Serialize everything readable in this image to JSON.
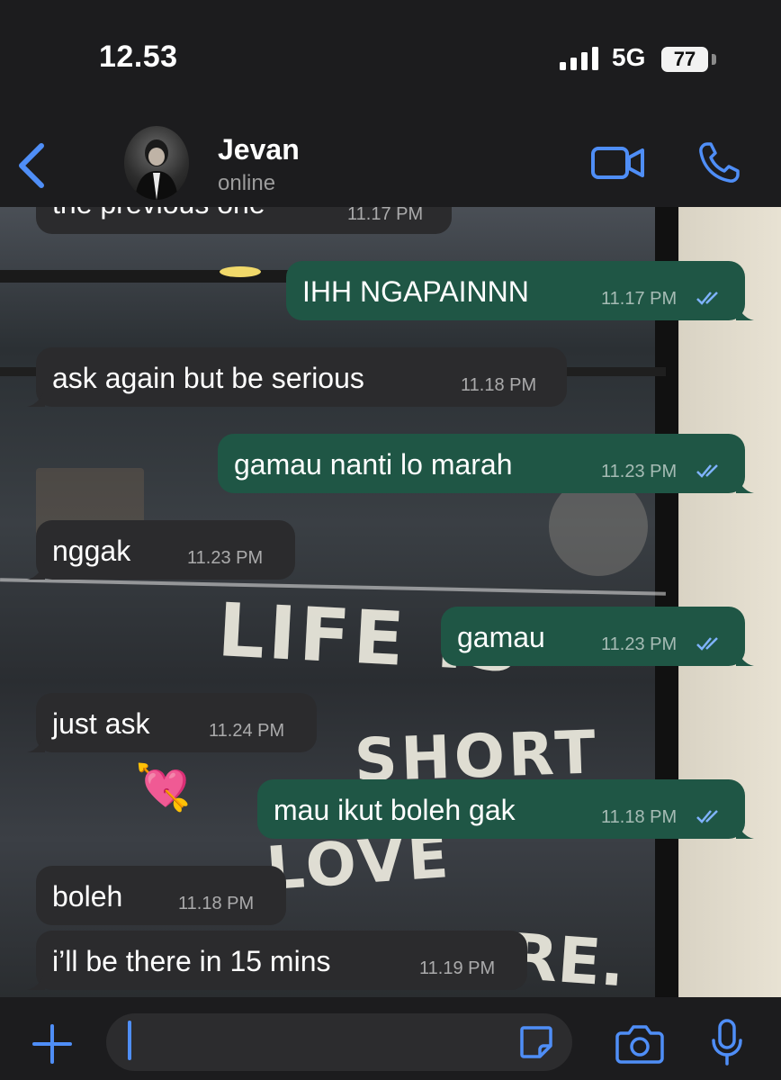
{
  "status_bar": {
    "time": "12.53",
    "network": "5G",
    "battery": "77"
  },
  "header": {
    "contact_name": "Jevan",
    "presence": "online"
  },
  "theme": {
    "accent": "#4f8ef7",
    "incoming_bubble": "#2b2b2d",
    "outgoing_bubble": "#1f5645",
    "read_ticks": "#7fb3ff"
  },
  "messages": [
    {
      "direction": "in",
      "text": "the previous one",
      "time": "11.17 PM"
    },
    {
      "direction": "out",
      "text": "IHH NGAPAINNN",
      "time": "11.17 PM"
    },
    {
      "direction": "in",
      "text": "ask again but be serious",
      "time": "11.18 PM"
    },
    {
      "direction": "out",
      "text": "gamau nanti lo marah",
      "time": "11.23 PM"
    },
    {
      "direction": "in",
      "text": "nggak",
      "time": "11.23 PM"
    },
    {
      "direction": "out",
      "text": "gamau",
      "time": "11.23 PM"
    },
    {
      "direction": "in",
      "text": "just ask",
      "time": "11.24 PM"
    },
    {
      "direction": "out",
      "text": "mau ikut boleh gak",
      "time": "11.18 PM"
    },
    {
      "direction": "in",
      "text": "boleh",
      "time": "11.18 PM"
    },
    {
      "direction": "in",
      "text": "i’ll be there in 15 mins",
      "time": "11.19 PM"
    }
  ],
  "wallpaper_text": {
    "line1": "LIFE IS",
    "line2": "SHORT",
    "line3": "LOVE",
    "line4": "RE."
  },
  "reaction_emoji": "💘",
  "icons": {
    "back": "chevron-left-icon",
    "video": "video-camera-icon",
    "call": "phone-icon",
    "attach": "plus-icon",
    "sticker": "sticker-icon",
    "camera": "camera-icon",
    "mic": "microphone-icon"
  }
}
